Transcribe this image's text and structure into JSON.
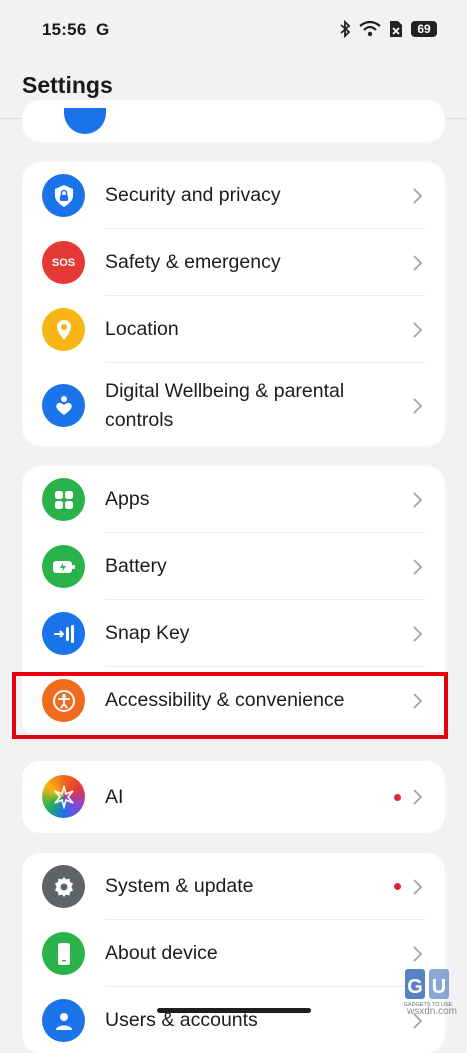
{
  "status": {
    "time": "15:56",
    "carrier_icon_letter": "G",
    "battery": "69"
  },
  "header": {
    "title": "Settings"
  },
  "groups": [
    {
      "items": [
        {
          "label": "Security and privacy",
          "icon": "shield-lock-icon",
          "color": "#1a73e8"
        },
        {
          "label": "Safety & emergency",
          "icon_text": "SOS",
          "icon": "sos-icon",
          "color": "#e53935"
        },
        {
          "label": "Location",
          "icon": "location-pin-icon",
          "color": "#f7b614"
        },
        {
          "label": "Digital Wellbeing & parental controls",
          "icon": "wellbeing-heart-icon",
          "color": "#1a73e8"
        }
      ]
    },
    {
      "items": [
        {
          "label": "Apps",
          "icon": "apps-grid-icon",
          "color": "#2ab34a"
        },
        {
          "label": "Battery",
          "icon": "battery-icon",
          "color": "#2ab34a"
        },
        {
          "label": "Snap Key",
          "icon": "snap-key-icon",
          "color": "#1a73e8"
        },
        {
          "label": "Accessibility & convenience",
          "icon": "accessibility-icon",
          "color": "#f26a1b",
          "highlighted": true
        }
      ]
    },
    {
      "items": [
        {
          "label": "AI",
          "icon": "ai-sparkle-icon",
          "color": "#8f44d4",
          "dot": true
        }
      ]
    },
    {
      "items": [
        {
          "label": "System & update",
          "icon": "gear-icon",
          "color": "#5f6368",
          "dot": true
        },
        {
          "label": "About device",
          "icon": "phone-icon",
          "color": "#2ab34a"
        },
        {
          "label": "Users & accounts",
          "icon": "user-icon",
          "color": "#1a73e8"
        }
      ]
    }
  ],
  "watermark": {
    "text": "GADGETS TO USE",
    "site": "wsxdn.com"
  }
}
